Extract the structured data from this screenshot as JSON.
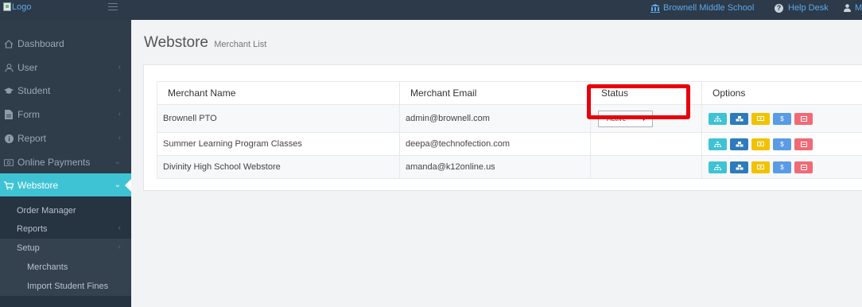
{
  "topbar": {
    "logo_alt": "Logo",
    "school": "Brownell Middle School",
    "help": "Help Desk",
    "user": "M"
  },
  "sidebar": {
    "items": [
      {
        "label": "Dashboard",
        "icon": "home-icon"
      },
      {
        "label": "User",
        "icon": "user-icon"
      },
      {
        "label": "Student",
        "icon": "graduation-cap-icon"
      },
      {
        "label": "Form",
        "icon": "file-icon"
      },
      {
        "label": "Report",
        "icon": "info-icon"
      },
      {
        "label": "Online Payments",
        "icon": "credit-card-icon"
      },
      {
        "label": "Webstore",
        "icon": "cart-icon"
      }
    ],
    "webstore_sub": {
      "order_manager": "Order Manager",
      "reports": "Reports",
      "setup": "Setup",
      "merchants": "Merchants",
      "import_fines": "Import Student Fines"
    }
  },
  "page": {
    "title": "Webstore",
    "subtitle": "Merchant List"
  },
  "table": {
    "headers": [
      "Merchant Name",
      "Merchant Email",
      "Status",
      "Options"
    ],
    "rows": [
      {
        "name": "Brownell PTO",
        "email": "admin@brownell.com",
        "status": "Active"
      },
      {
        "name": "Summer Learning Program Classes",
        "email": "deepa@technofection.com",
        "status": ""
      },
      {
        "name": "Divinity High School Webstore",
        "email": "amanda@k12online.us",
        "status": ""
      }
    ],
    "option_buttons": [
      {
        "icon": "sitemap-icon",
        "color": "#3ec3d4"
      },
      {
        "icon": "cubes-icon",
        "color": "#2e7bbb"
      },
      {
        "icon": "money-icon",
        "color": "#f2c200"
      },
      {
        "icon": "dollar-icon",
        "color": "#5b9be6"
      },
      {
        "icon": "minus-square-icon",
        "color": "#f06a75"
      }
    ]
  },
  "colors": {
    "topbar": "#2c3a4a",
    "sidebar": "#2f3c4a",
    "accent": "#3ec3d4",
    "highlight": "#e8000b"
  }
}
